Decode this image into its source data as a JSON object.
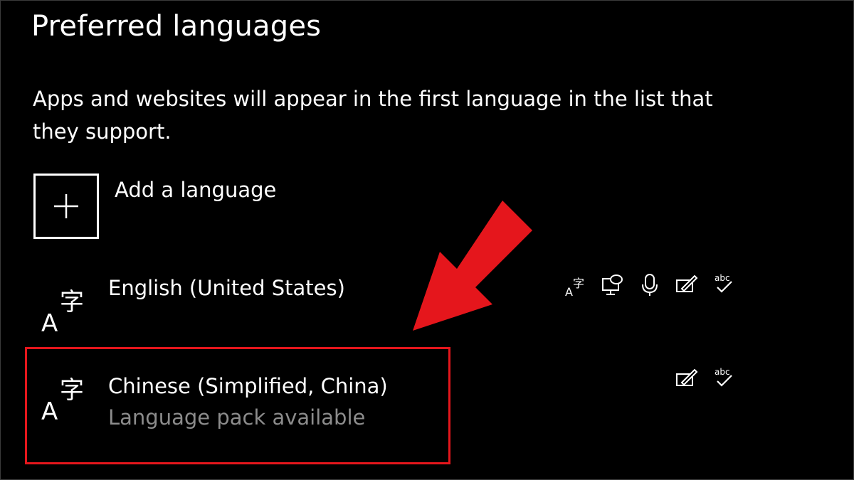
{
  "section": {
    "title": "Preferred languages",
    "description": "Apps and websites will appear in the first language in the list that they support."
  },
  "add_language": {
    "label": "Add a language",
    "icon": "plus-icon"
  },
  "languages": [
    {
      "name": "English (United States)",
      "icon": "language-icon",
      "features": [
        "display-language-icon",
        "text-to-speech-icon",
        "speech-recognition-icon",
        "handwriting-icon",
        "spell-check-icon"
      ]
    },
    {
      "name": "Chinese (Simplified, China)",
      "status": "Language pack available",
      "icon": "language-icon",
      "features": [
        "handwriting-icon",
        "spell-check-icon"
      ]
    }
  ],
  "annotation": {
    "color": "#e5161c"
  }
}
